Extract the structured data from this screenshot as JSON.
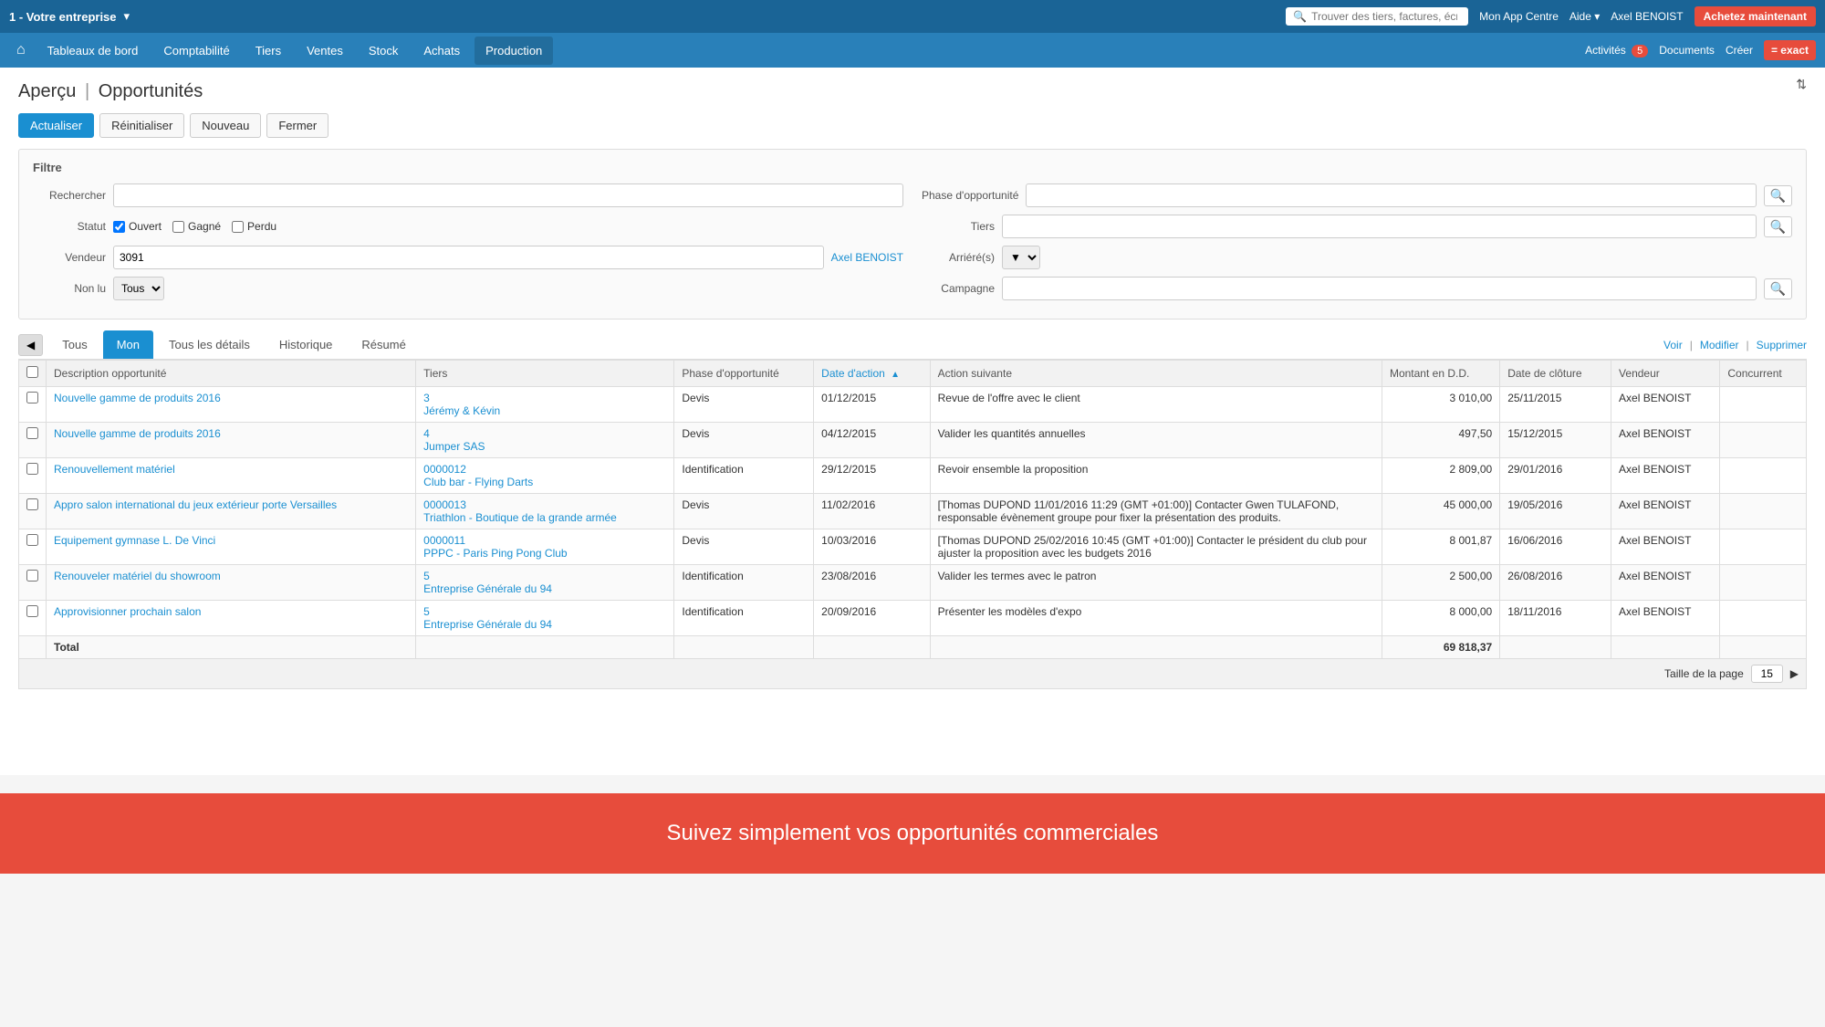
{
  "app": {
    "company": "1 - Votre entreprise",
    "search_placeholder": "Trouver des tiers, factures, écr...",
    "top_links": {
      "mon_app": "Mon App Centre",
      "aide": "Aide",
      "user": "Axel BENOIST",
      "achetez": "Achetez maintenant"
    }
  },
  "nav": {
    "home_icon": "⌂",
    "items": [
      {
        "label": "Tableaux de bord",
        "active": false
      },
      {
        "label": "Comptabilité",
        "active": false
      },
      {
        "label": "Tiers",
        "active": false
      },
      {
        "label": "Ventes",
        "active": false
      },
      {
        "label": "Stock",
        "active": false
      },
      {
        "label": "Achats",
        "active": false
      },
      {
        "label": "Production",
        "active": true
      }
    ],
    "right": {
      "activites": "Activités",
      "activites_count": "5",
      "documents": "Documents",
      "creer": "Créer",
      "exact_logo": "= exact"
    }
  },
  "page": {
    "breadcrumb_1": "Aperçu",
    "breadcrumb_2": "Opportunités",
    "title_full": "Aperçu | Opportunités"
  },
  "toolbar": {
    "actualiser": "Actualiser",
    "reinitialiser": "Réinitialiser",
    "nouveau": "Nouveau",
    "fermer": "Fermer"
  },
  "filter": {
    "title": "Filtre",
    "rechercher_label": "Rechercher",
    "phase_label": "Phase d'opportunité",
    "statut_label": "Statut",
    "statut_options": [
      {
        "id": "ouvert",
        "label": "Ouvert",
        "checked": true
      },
      {
        "id": "gagne",
        "label": "Gagné",
        "checked": false
      },
      {
        "id": "perdu",
        "label": "Perdu",
        "checked": false
      }
    ],
    "tiers_label": "Tiers",
    "vendeur_label": "Vendeur",
    "vendeur_value": "3091",
    "vendeur_link": "Axel BENOIST",
    "arrieres_label": "Arriéré(s)",
    "non_lu_label": "Non lu",
    "non_lu_value": "Tous",
    "campagne_label": "Campagne"
  },
  "tabs": {
    "items": [
      {
        "label": "Tous",
        "active": false
      },
      {
        "label": "Mon",
        "active": true
      },
      {
        "label": "Tous les détails",
        "active": false
      },
      {
        "label": "Historique",
        "active": false
      },
      {
        "label": "Résumé",
        "active": false
      }
    ],
    "actions": {
      "voir": "Voir",
      "modifier": "Modifier",
      "supprimer": "Supprimer"
    }
  },
  "table": {
    "columns": [
      {
        "label": "",
        "key": "check"
      },
      {
        "label": "Description opportunité",
        "key": "description"
      },
      {
        "label": "Tiers",
        "key": "tiers"
      },
      {
        "label": "Phase d'opportunité",
        "key": "phase"
      },
      {
        "label": "Date d'action",
        "key": "date_action",
        "sorted": true
      },
      {
        "label": "Action suivante",
        "key": "action_suivante"
      },
      {
        "label": "Montant en D.D.",
        "key": "montant"
      },
      {
        "label": "Date de clôture",
        "key": "date_cloture"
      },
      {
        "label": "Vendeur",
        "key": "vendeur"
      },
      {
        "label": "Concurrent",
        "key": "concurrent"
      }
    ],
    "rows": [
      {
        "description": "Nouvelle gamme de produits 2016",
        "tiers_num": "3",
        "tiers_name": "Jérémy & Kévin",
        "phase": "Devis",
        "date_action": "01/12/2015",
        "action_suivante": "Revue de l'offre avec le client",
        "montant": "3 010,00",
        "date_cloture": "25/11/2015",
        "vendeur": "Axel BENOIST",
        "concurrent": ""
      },
      {
        "description": "Nouvelle gamme de produits 2016",
        "tiers_num": "4",
        "tiers_name": "Jumper SAS",
        "phase": "Devis",
        "date_action": "04/12/2015",
        "action_suivante": "Valider les quantités annuelles",
        "montant": "497,50",
        "date_cloture": "15/12/2015",
        "vendeur": "Axel BENOIST",
        "concurrent": ""
      },
      {
        "description": "Renouvellement matériel",
        "tiers_num": "0000012",
        "tiers_name": "Club bar - Flying Darts",
        "phase": "Identification",
        "date_action": "29/12/2015",
        "action_suivante": "Revoir ensemble la proposition",
        "montant": "2 809,00",
        "date_cloture": "29/01/2016",
        "vendeur": "Axel BENOIST",
        "concurrent": ""
      },
      {
        "description": "Appro salon international du jeux extérieur porte Versailles",
        "tiers_num": "0000013",
        "tiers_name": "Triathlon - Boutique de la grande armée",
        "phase": "Devis",
        "date_action": "11/02/2016",
        "action_suivante": "[Thomas DUPOND 11/01/2016 11:29 (GMT +01:00)] Contacter Gwen TULAFOND, responsable évènement groupe pour fixer la présentation des produits.",
        "montant": "45 000,00",
        "date_cloture": "19/05/2016",
        "vendeur": "Axel BENOIST",
        "concurrent": ""
      },
      {
        "description": "Equipement gymnase L. De Vinci",
        "tiers_num": "0000011",
        "tiers_name": "PPPC - Paris Ping Pong Club",
        "phase": "Devis",
        "date_action": "10/03/2016",
        "action_suivante": "[Thomas DUPOND 25/02/2016 10:45 (GMT +01:00)] Contacter le président du club pour ajuster la proposition avec les budgets 2016",
        "montant": "8 001,87",
        "date_cloture": "16/06/2016",
        "vendeur": "Axel BENOIST",
        "concurrent": ""
      },
      {
        "description": "Renouveler matériel du showroom",
        "tiers_num": "5",
        "tiers_name": "Entreprise Générale du 94",
        "phase": "Identification",
        "date_action": "23/08/2016",
        "action_suivante": "Valider les termes avec le patron",
        "montant": "2 500,00",
        "date_cloture": "26/08/2016",
        "vendeur": "Axel BENOIST",
        "concurrent": ""
      },
      {
        "description": "Approvisionner prochain salon",
        "tiers_num": "5",
        "tiers_name": "Entreprise Générale du 94",
        "phase": "Identification",
        "date_action": "20/09/2016",
        "action_suivante": "Présenter les modèles d'expo",
        "montant": "8 000,00",
        "date_cloture": "18/11/2016",
        "vendeur": "Axel BENOIST",
        "concurrent": ""
      }
    ],
    "total_label": "Total",
    "total_montant": "69 818,37",
    "page_size_label": "Taille de la page",
    "page_size_value": "15"
  },
  "banner": {
    "text": "Suivez simplement vos opportunités commerciales"
  }
}
